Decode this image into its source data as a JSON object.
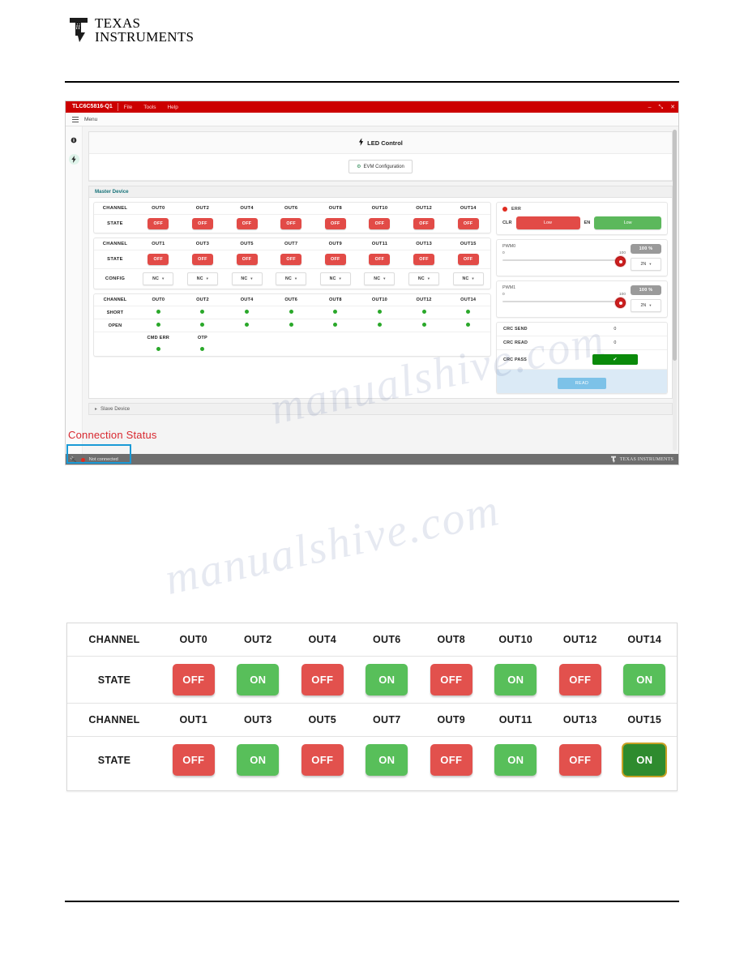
{
  "page": {
    "brand_line1": "TEXAS",
    "brand_line2": "INSTRUMENTS",
    "watermark": "manualshive.com"
  },
  "app": {
    "title": "TLC6C5816-Q1",
    "menus": [
      "File",
      "Tools",
      "Help"
    ],
    "window_controls": {
      "minimize": "–",
      "maximize": "⤡",
      "close": "✕"
    },
    "menubar": {
      "hamburger_icon": "hamburger-icon",
      "label": "Menu"
    },
    "rail_icons": [
      "info-icon",
      "bolt-icon"
    ],
    "led_control": {
      "icon": "bolt-icon",
      "title": "LED Control"
    },
    "evm_button": {
      "icon": "link-icon",
      "label": "EVM Configuration"
    },
    "master_panel": {
      "title": "Master Device"
    },
    "slave_panel": {
      "title": "Slave Device",
      "chevron": "chevron-right-icon"
    },
    "channel_table": {
      "row_labels": {
        "channel": "CHANNEL",
        "state": "STATE",
        "config": "CONFIG"
      },
      "even_channels": [
        "OUT0",
        "OUT2",
        "OUT4",
        "OUT6",
        "OUT8",
        "OUT10",
        "OUT12",
        "OUT14"
      ],
      "even_states": [
        "OFF",
        "OFF",
        "OFF",
        "OFF",
        "OFF",
        "OFF",
        "OFF",
        "OFF"
      ],
      "odd_channels": [
        "OUT1",
        "OUT3",
        "OUT5",
        "OUT7",
        "OUT9",
        "OUT11",
        "OUT13",
        "OUT15"
      ],
      "odd_states": [
        "OFF",
        "OFF",
        "OFF",
        "OFF",
        "OFF",
        "OFF",
        "OFF",
        "OFF"
      ],
      "config_values": [
        "NC",
        "NC",
        "NC",
        "NC",
        "NC",
        "NC",
        "NC",
        "NC"
      ]
    },
    "diagnostics": {
      "row_labels": {
        "channel": "CHANNEL",
        "short": "SHORT",
        "open": "OPEN"
      },
      "channels": [
        "OUT0",
        "OUT2",
        "OUT4",
        "OUT6",
        "OUT8",
        "OUT10",
        "OUT12",
        "OUT14"
      ],
      "short_status": [
        "ok",
        "ok",
        "ok",
        "ok",
        "ok",
        "ok",
        "ok",
        "ok"
      ],
      "open_status": [
        "ok",
        "ok",
        "ok",
        "ok",
        "ok",
        "ok",
        "ok",
        "ok"
      ],
      "extra_labels": [
        "CMD ERR",
        "OTP"
      ],
      "extra_status": [
        "ok",
        "ok"
      ]
    },
    "status_panel": {
      "err_indicator": {
        "label": "ERR",
        "state": "red"
      },
      "clr": {
        "label": "CLR",
        "value": "Low",
        "color": "#e24b47"
      },
      "en": {
        "label": "EN",
        "value": "Low",
        "color": "#5cb85c"
      },
      "pwm": [
        {
          "name": "PWM0",
          "min": "0",
          "max": "100",
          "percent": "100 %",
          "select": "2N"
        },
        {
          "name": "PWM1",
          "min": "0",
          "max": "100",
          "percent": "100 %",
          "select": "2N"
        }
      ]
    },
    "crc": {
      "rows": [
        {
          "label": "CRC SEND",
          "value": "0"
        },
        {
          "label": "CRC READ",
          "value": "0"
        }
      ],
      "pass_label": "CRC PASS",
      "pass_icon": "check-circle-icon",
      "read_button": "READ"
    },
    "statusbar": {
      "plug_icon": "plug-icon",
      "status": "Not connected",
      "brand": "TEXAS INSTRUMENTS"
    }
  },
  "annotation": {
    "callout": "Connection Status"
  },
  "zoom_shot": {
    "row_labels": {
      "channel": "CHANNEL",
      "state": "STATE"
    },
    "even_channels": [
      "OUT0",
      "OUT2",
      "OUT4",
      "OUT6",
      "OUT8",
      "OUT10",
      "OUT12",
      "OUT14"
    ],
    "even_states": [
      "OFF",
      "ON",
      "OFF",
      "ON",
      "OFF",
      "ON",
      "OFF",
      "ON"
    ],
    "odd_channels": [
      "OUT1",
      "OUT3",
      "OUT5",
      "OUT7",
      "OUT9",
      "OUT11",
      "OUT13",
      "OUT15"
    ],
    "odd_states": [
      "OFF",
      "ON",
      "OFF",
      "ON",
      "OFF",
      "ON",
      "OFF",
      "ON"
    ],
    "focused_index": 7
  }
}
